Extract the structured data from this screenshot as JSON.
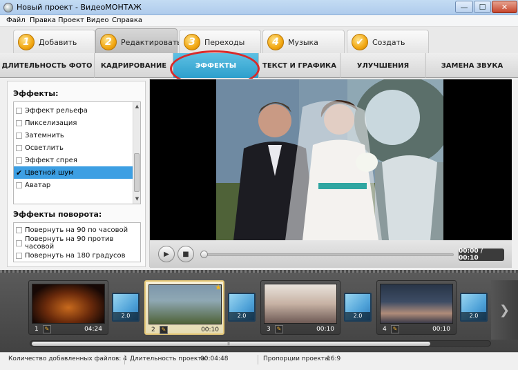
{
  "window": {
    "title": "Новый проект - ВидеоМОНТАЖ",
    "minimize": "—",
    "maximize": "☐",
    "close": "✕"
  },
  "menu": [
    "Файл",
    "Правка",
    "Проект",
    "Видео",
    "Справка"
  ],
  "wizard_tabs": [
    {
      "num": "1",
      "label": "Добавить"
    },
    {
      "num": "2",
      "label": "Редактировать"
    },
    {
      "num": "3",
      "label": "Переходы"
    },
    {
      "num": "4",
      "label": "Музыка"
    },
    {
      "num": "✔",
      "label": "Создать"
    }
  ],
  "sub_tabs": [
    "ДЛИТЕЛЬНОСТЬ ФОТО",
    "КАДРИРОВАНИЕ",
    "ЭФФЕКТЫ",
    "ТЕКСТ И ГРАФИКА",
    "УЛУЧШЕНИЯ",
    "ЗАМЕНА ЗВУКА"
  ],
  "effects": {
    "title": "Эффекты:",
    "items": [
      "Эффект рельефа",
      "Пикселизация",
      "Затемнить",
      "Осветлить",
      "Эффект спрея",
      "Цветной шум",
      "Аватар"
    ],
    "selected_item": "Цветной шум",
    "check_mark": "✔"
  },
  "rotation": {
    "title": "Эффекты поворота:",
    "items": [
      "Повернуть на 90 по часовой",
      "Повернуть на 90 против часовой",
      "Повернуть на 180 градусов"
    ]
  },
  "player": {
    "time": "00:00 / 00:10",
    "play": "▶",
    "stop": "■",
    "playback_progress": 0
  },
  "timeline": {
    "clips": [
      {
        "num": "1",
        "duration": "04:24"
      },
      {
        "num": "2",
        "duration": "00:10"
      },
      {
        "num": "3",
        "duration": "00:10"
      },
      {
        "num": "4",
        "duration": "00:10"
      }
    ],
    "transitions": [
      "2.0",
      "2.0",
      "2.0",
      "2.0"
    ],
    "star": "★",
    "pen": "✎",
    "next": "❯",
    "grip": "|||"
  },
  "status": {
    "files_label": "Количество добавленных файлов: 4",
    "duration_label": "Длительность проекта:",
    "duration_value": "00:04:48",
    "ratio_label": "Пропорции проекта:",
    "ratio_value": "16:9"
  },
  "colors": {
    "accent_tab": "#2d9fcc",
    "selection": "#3d9fe3",
    "annotation_oval": "#d82a2a",
    "wizard_number": "#f2a711"
  }
}
